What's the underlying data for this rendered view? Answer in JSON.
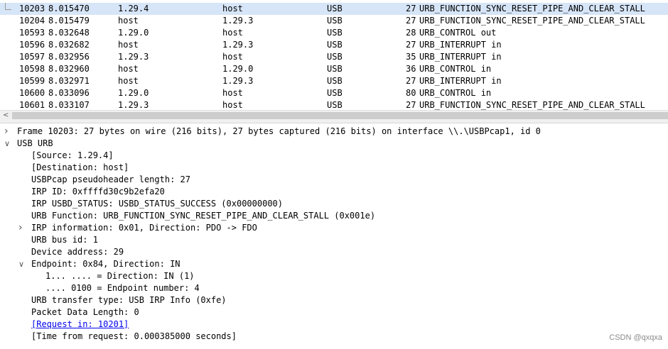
{
  "packets": [
    {
      "no": "10203",
      "time": "8.015470",
      "source": "1.29.4",
      "destination": "host",
      "protocol": "USB",
      "length": "27",
      "info": "URB_FUNCTION_SYNC_RESET_PIPE_AND_CLEAR_STALL",
      "selected": true
    },
    {
      "no": "10204",
      "time": "8.015479",
      "source": "host",
      "destination": "1.29.3",
      "protocol": "USB",
      "length": "27",
      "info": "URB_FUNCTION_SYNC_RESET_PIPE_AND_CLEAR_STALL",
      "selected": false
    },
    {
      "no": "10593",
      "time": "8.032648",
      "source": "1.29.0",
      "destination": "host",
      "protocol": "USB",
      "length": "28",
      "info": "URB_CONTROL out",
      "selected": false
    },
    {
      "no": "10596",
      "time": "8.032682",
      "source": "host",
      "destination": "1.29.3",
      "protocol": "USB",
      "length": "27",
      "info": "URB_INTERRUPT in",
      "selected": false
    },
    {
      "no": "10597",
      "time": "8.032956",
      "source": "1.29.3",
      "destination": "host",
      "protocol": "USB",
      "length": "35",
      "info": "URB_INTERRUPT in",
      "selected": false
    },
    {
      "no": "10598",
      "time": "8.032960",
      "source": "host",
      "destination": "1.29.0",
      "protocol": "USB",
      "length": "36",
      "info": "URB_CONTROL in",
      "selected": false
    },
    {
      "no": "10599",
      "time": "8.032971",
      "source": "host",
      "destination": "1.29.3",
      "protocol": "USB",
      "length": "27",
      "info": "URB_INTERRUPT in",
      "selected": false
    },
    {
      "no": "10600",
      "time": "8.033096",
      "source": "1.29.0",
      "destination": "host",
      "protocol": "USB",
      "length": "80",
      "info": "URB_CONTROL in",
      "selected": false
    },
    {
      "no": "10601",
      "time": "8.033107",
      "source": "1.29.3",
      "destination": "host",
      "protocol": "USB",
      "length": "27",
      "info": "URB_FUNCTION_SYNC_RESET_PIPE_AND_CLEAR_STALL",
      "selected": false
    }
  ],
  "scrollbar": {
    "left_arrow": "<"
  },
  "details": [
    {
      "text": "Frame 10203: 27 bytes on wire (216 bits), 27 bytes captured (216 bits) on interface \\\\.\\USBPcap1, id 0",
      "level": 0,
      "toggle": "collapsed",
      "link": false
    },
    {
      "text": "USB URB",
      "level": 0,
      "toggle": "expanded",
      "link": false
    },
    {
      "text": "[Source: 1.29.4]",
      "level": 1,
      "toggle": "none",
      "link": false
    },
    {
      "text": "[Destination: host]",
      "level": 1,
      "toggle": "none",
      "link": false
    },
    {
      "text": "USBPcap pseudoheader length: 27",
      "level": 1,
      "toggle": "none",
      "link": false
    },
    {
      "text": "IRP ID: 0xffffd30c9b2efa20",
      "level": 1,
      "toggle": "none",
      "link": false
    },
    {
      "text": "IRP USBD_STATUS: USBD_STATUS_SUCCESS (0x00000000)",
      "level": 1,
      "toggle": "none",
      "link": false
    },
    {
      "text": "URB Function: URB_FUNCTION_SYNC_RESET_PIPE_AND_CLEAR_STALL (0x001e)",
      "level": 1,
      "toggle": "none",
      "link": false
    },
    {
      "text": "IRP information: 0x01, Direction: PDO -> FDO",
      "level": 1,
      "toggle": "collapsed",
      "link": false
    },
    {
      "text": "URB bus id: 1",
      "level": 1,
      "toggle": "none",
      "link": false
    },
    {
      "text": "Device address: 29",
      "level": 1,
      "toggle": "none",
      "link": false
    },
    {
      "text": "Endpoint: 0x84, Direction: IN",
      "level": 1,
      "toggle": "expanded",
      "link": false
    },
    {
      "text": "1... .... = Direction: IN (1)",
      "level": 2,
      "toggle": "none",
      "link": false
    },
    {
      "text": ".... 0100 = Endpoint number: 4",
      "level": 2,
      "toggle": "none",
      "link": false
    },
    {
      "text": "URB transfer type: USB IRP Info (0xfe)",
      "level": 1,
      "toggle": "none",
      "link": false
    },
    {
      "text": "Packet Data Length: 0",
      "level": 1,
      "toggle": "none",
      "link": false
    },
    {
      "text": "[Request in: 10201]",
      "level": 1,
      "toggle": "none",
      "link": true
    },
    {
      "text": "[Time from request: 0.000385000 seconds]",
      "level": 1,
      "toggle": "none",
      "link": false
    }
  ],
  "watermark": "CSDN @qxqxa",
  "colors": {
    "selected_row": "#d6e5f7",
    "link": "#0000ee"
  }
}
